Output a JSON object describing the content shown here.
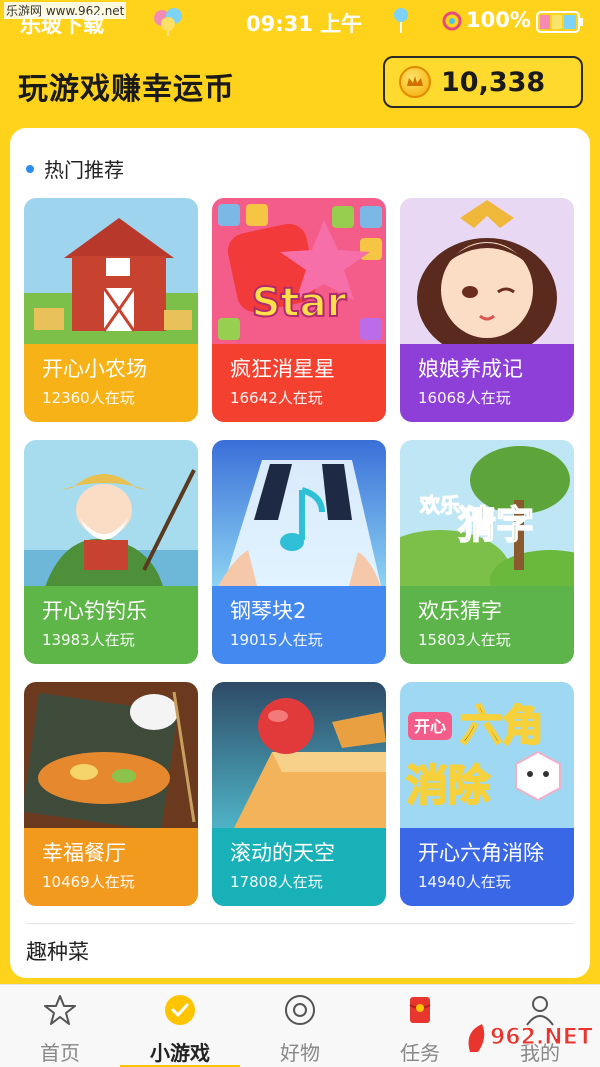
{
  "status_bar": {
    "watermark": "乐游网 www.962.net",
    "carrier": "乐玻下载",
    "time": "09:31 上午",
    "battery": "100%"
  },
  "header": {
    "title": "玩游戏赚幸运币",
    "coin_count": "10,338",
    "coin_icon": "coin-icon"
  },
  "hot": {
    "section_label": "热门推荐",
    "games": [
      {
        "name": "开心小农场",
        "players": "12360人在玩",
        "color": "#F6B216"
      },
      {
        "name": "疯狂消星星",
        "players": "16642人在玩",
        "color": "#F4402E"
      },
      {
        "name": "娘娘养成记",
        "players": "16068人在玩",
        "color": "#8E3FD8"
      },
      {
        "name": "开心钓钓乐",
        "players": "13983人在玩",
        "color": "#5DB647"
      },
      {
        "name": "钢琴块2",
        "players": "19015人在玩",
        "color": "#4389F0"
      },
      {
        "name": "欢乐猜字",
        "players": "15803人在玩",
        "color": "#5DB44A"
      },
      {
        "name": "幸福餐厅",
        "players": "10469人在玩",
        "color": "#F29A1E"
      },
      {
        "name": "滚动的天空",
        "players": "17808人在玩",
        "color": "#18B1B7"
      },
      {
        "name": "开心六角消除",
        "players": "14940人在玩",
        "color": "#3A67E6"
      }
    ]
  },
  "fun_section": {
    "label": "趣种菜"
  },
  "nav": {
    "items": [
      {
        "label": "首页",
        "icon": "star-icon"
      },
      {
        "label": "小游戏",
        "icon": "check-icon"
      },
      {
        "label": "好物",
        "icon": "target-icon"
      },
      {
        "label": "任务",
        "icon": "red-envelope-icon"
      },
      {
        "label": "我的",
        "icon": "person-icon"
      }
    ],
    "active_index": 1
  },
  "watermark_logo": "962.NET 乐游网",
  "art_text": {
    "star": "Star",
    "guess_small": "欢乐",
    "guess_big": "猜字",
    "hex_top": "开心",
    "hex_big1": "六角",
    "hex_big2": "消除"
  }
}
